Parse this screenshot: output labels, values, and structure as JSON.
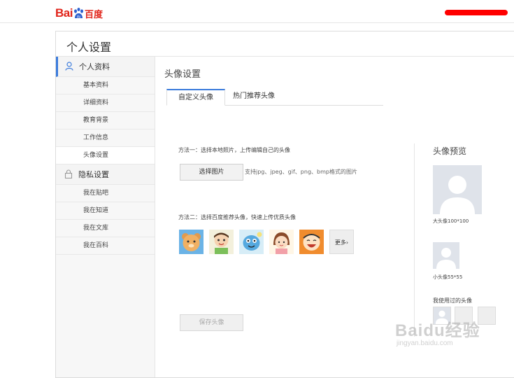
{
  "header": {
    "logo_text": "Bai",
    "logo_suffix": "百度",
    "user_name_redacted": ""
  },
  "panel": {
    "title": "个人设置"
  },
  "sidebar": {
    "sections": [
      {
        "label": "个人资料",
        "icon": "user-icon",
        "items": [
          "基本资料",
          "详细资料",
          "教育背景",
          "工作信息",
          "头像设置"
        ]
      },
      {
        "label": "隐私设置",
        "icon": "lock-icon",
        "items": [
          "我在贴吧",
          "我在知道",
          "我在文库",
          "我在百科"
        ]
      }
    ]
  },
  "content": {
    "title": "头像设置",
    "tabs": [
      "自定义头像",
      "热门推荐头像"
    ],
    "method1": "方法一：选择本地照片，上传编辑自己的头像",
    "choose_button": "选择图片",
    "formats": "支持jpg、jpeg、gif、png、bmp格式的图片",
    "method2": "方法二：选择百度推荐头像，快速上传优质头像",
    "more_label": "更多›",
    "save_button": "保存头像"
  },
  "preview": {
    "title": "头像预览",
    "big_label": "大头像100*100",
    "small_label": "小头像55*55",
    "used_label": "我使用过的头像"
  },
  "watermark": {
    "line1": "Baidu经验",
    "line2": "jingyan.baidu.com"
  },
  "colors": {
    "accent": "#3b7bdc",
    "brand": "#e1251b"
  }
}
